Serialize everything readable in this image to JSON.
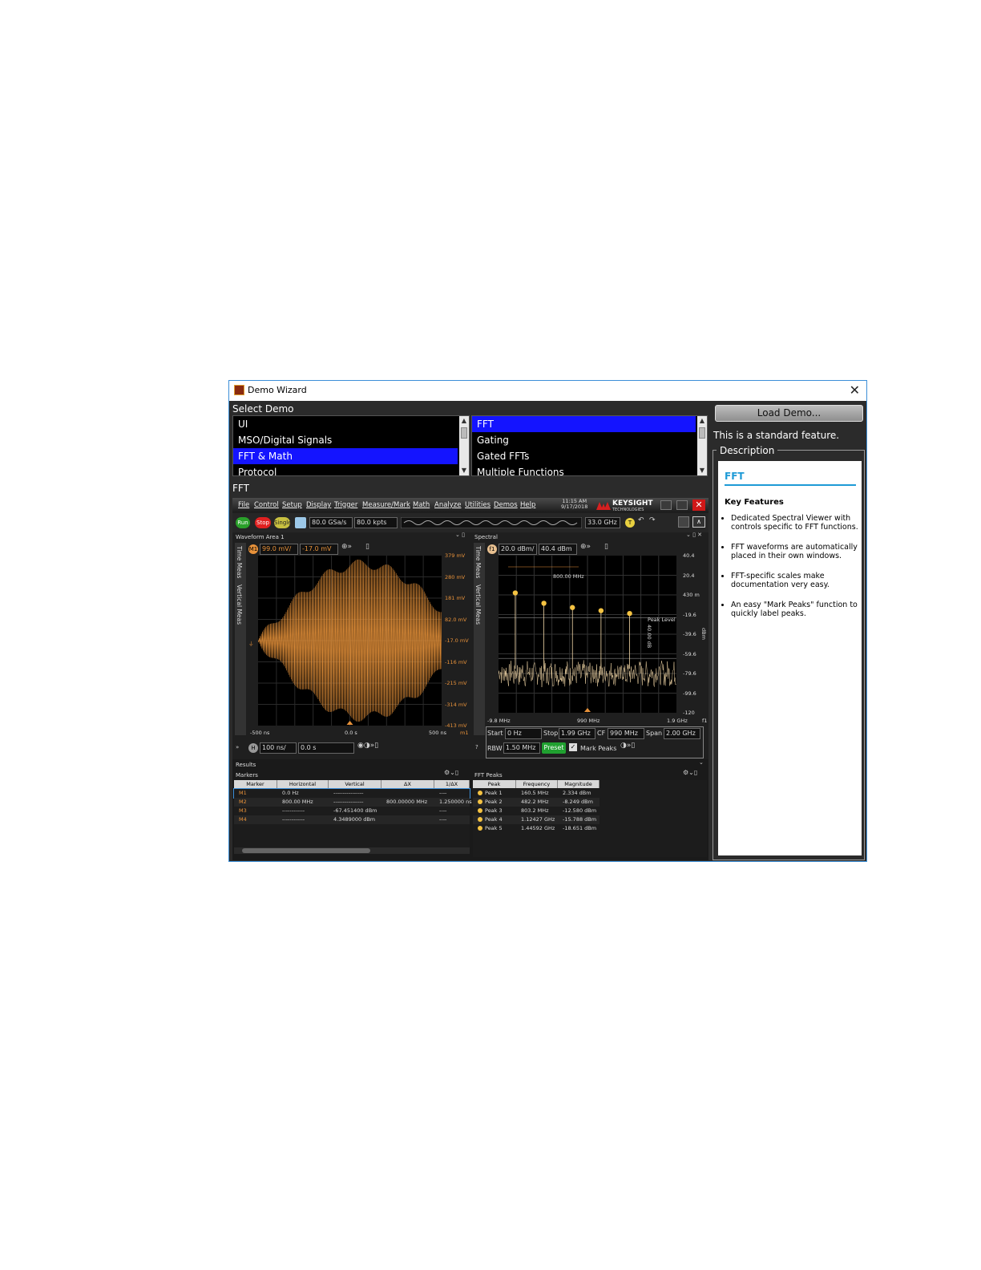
{
  "window": {
    "title": "Demo Wizard",
    "close_glyph": "✕"
  },
  "select_demo": {
    "label": "Select Demo",
    "categories": [
      "UI",
      "MSO/Digital Signals",
      "FFT & Math",
      "Protocol"
    ],
    "features": [
      "FFT",
      "Gating",
      "Gated FFTs",
      "Multiple Functions"
    ]
  },
  "selected_demo_label": "FFT",
  "load_button": "Load Demo...",
  "standard_feature_text": "This is a standard feature.",
  "description": {
    "legend": "Description",
    "heading": "FFT",
    "key_features_title": "Key Features",
    "bullets": [
      "Dedicated Spectral Viewer with controls specific to FFT functions.",
      "FFT waveforms are automatically placed in their own windows.",
      "FFT-specific scales make documentation very easy.",
      "An easy \"Mark Peaks\" function to quickly label peaks."
    ]
  },
  "scope": {
    "menu": [
      "File",
      "Control",
      "Setup",
      "Display",
      "Trigger",
      "Measure/Mark",
      "Math",
      "Analyze",
      "Utilities",
      "Demos",
      "Help"
    ],
    "time": "11:15 AM",
    "date": "9/17/2018",
    "brand": "KEYSIGHT",
    "brand_sub": "TECHNOLOGIES",
    "close_glyph": "✕",
    "toolbar": {
      "run": "Run",
      "stop": "Stop",
      "single": "Single",
      "sample_rate": "80.0 GSa/s",
      "points": "80.0 kpts",
      "bandwidth": "33.0 GHz",
      "trig": "T"
    },
    "waveform": {
      "title": "Waveform Area 1",
      "vscale": "99.0 mV/",
      "voffset": "-17.0 mV",
      "m_badge": "M1",
      "tabs": [
        "Time Meas",
        "Vertical Meas"
      ],
      "y_ticks": [
        "379 mV",
        "280 mV",
        "181 mV",
        "82.0 mV",
        "-17.0 mV",
        "-116 mV",
        "-215 mV",
        "-314 mV",
        "-413 mV"
      ],
      "x_ticks": [
        "-500 ns",
        "0.0 s",
        "500 ns"
      ],
      "marker_label": "m1",
      "hscale": "100 ns/",
      "hpos": "0.0 s",
      "h_badge": "H"
    },
    "spectral": {
      "title": "Spectral",
      "vscale": "20.0 dBm/",
      "voffset": "40.4 dBm",
      "f_badge": "f1",
      "tabs": [
        "Time Meas",
        "Vertical Meas"
      ],
      "y_ticks": [
        "40.4",
        "20.4",
        "430 m",
        "-19.6",
        "-39.6",
        "-59.6",
        "-79.6",
        "-99.6",
        "-120"
      ],
      "y_unit": "dBm",
      "x_ticks": [
        "-9.8 MHz",
        "990 MHz",
        "1.9 GHz"
      ],
      "f_label": "f1",
      "span_annotation": "800.00 MHz",
      "peak_level_label": "Peak Level",
      "db_annotation": "40.00 dB",
      "start_label": "Start",
      "start_value": "0 Hz",
      "stop_label": "Stop",
      "stop_value": "1.99 GHz",
      "cf_label": "CF",
      "cf_value": "990 MHz",
      "span_label": "Span",
      "span_value": "2.00 GHz",
      "rbw_label": "RBW",
      "rbw_value": "1.50 MHz",
      "preset": "Preset",
      "mark_peaks": "Mark Peaks",
      "peak_levels_dbm": [
        2.334,
        -8.249,
        -12.58,
        -15.788,
        -18.651
      ]
    },
    "results": {
      "title": "Results",
      "markers_title": "Markers",
      "marker_headers": [
        "Marker",
        "Horizontal",
        "Vertical",
        "ΔX",
        "1/ΔX"
      ],
      "marker_rows": [
        {
          "marker": "M1",
          "horizontal": "0.0 Hz",
          "vertical": "----------------",
          "dx": "",
          "inv": "----"
        },
        {
          "marker": "M2",
          "horizontal": "800.00 MHz",
          "vertical": "----------------",
          "dx": "800.00000 MHz",
          "inv": "1.250000 ns"
        },
        {
          "marker": "M3",
          "horizontal": "------------",
          "vertical": "-67.451400 dBm",
          "dx": "",
          "inv": "----"
        },
        {
          "marker": "M4",
          "horizontal": "------------",
          "vertical": "4.3489000 dBm",
          "dx": "",
          "inv": "----"
        }
      ],
      "fft_title": "FFT Peaks",
      "fft_headers": [
        "Peak",
        "Frequency",
        "Magnitude"
      ],
      "fft_rows": [
        {
          "peak": "Peak 1",
          "frequency": "160.5 MHz",
          "magnitude": "2.334 dBm"
        },
        {
          "peak": "Peak 2",
          "frequency": "482.2 MHz",
          "magnitude": "-8.249 dBm"
        },
        {
          "peak": "Peak 3",
          "frequency": "803.2 MHz",
          "magnitude": "-12.580 dBm"
        },
        {
          "peak": "Peak 4",
          "frequency": "1.12427 GHz",
          "magnitude": "-15.788 dBm"
        },
        {
          "peak": "Peak 5",
          "frequency": "1.44592 GHz",
          "magnitude": "-18.651 dBm"
        }
      ]
    }
  },
  "colors": {
    "selection": "#1414ff",
    "waveform": "#e8923a",
    "spectrum": "#f3d8a8",
    "accent": "#1e9ad6"
  }
}
